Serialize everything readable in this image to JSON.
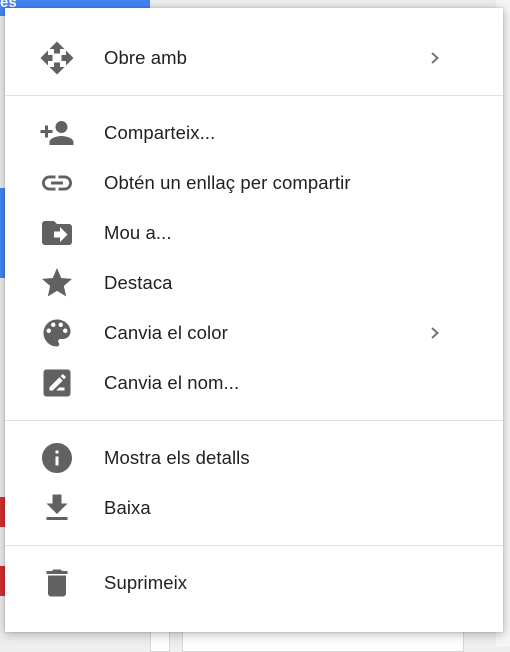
{
  "background": {
    "top_partial_text": "es"
  },
  "menu": {
    "groups": [
      {
        "items": [
          {
            "label": "Obre amb",
            "icon": "move-arrows-icon",
            "submenu": true
          }
        ]
      },
      {
        "items": [
          {
            "label": "Comparteix...",
            "icon": "person-add-icon",
            "submenu": false
          },
          {
            "label": "Obtén un enllaç per compartir",
            "icon": "link-icon",
            "submenu": false
          },
          {
            "label": "Mou a...",
            "icon": "folder-move-icon",
            "submenu": false
          },
          {
            "label": "Destaca",
            "icon": "star-icon",
            "submenu": false
          },
          {
            "label": "Canvia el color",
            "icon": "palette-icon",
            "submenu": true
          },
          {
            "label": "Canvia el nom...",
            "icon": "rename-pencil-icon",
            "submenu": false
          }
        ]
      },
      {
        "items": [
          {
            "label": "Mostra els detalls",
            "icon": "info-icon",
            "submenu": false
          },
          {
            "label": "Baixa",
            "icon": "download-icon",
            "submenu": false
          }
        ]
      },
      {
        "items": [
          {
            "label": "Suprimeix",
            "icon": "trash-icon",
            "submenu": false
          }
        ]
      }
    ]
  },
  "colors": {
    "icon": "#616161",
    "text": "#212121",
    "divider": "#e0e0e0",
    "chevron": "#757575"
  }
}
